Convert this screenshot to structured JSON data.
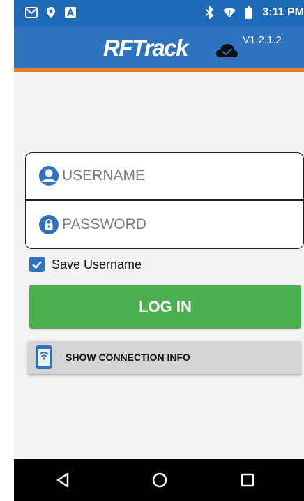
{
  "status_bar": {
    "time": "3:11 PM",
    "icons": [
      "gmail-icon",
      "location-pin-icon",
      "app-a-icon",
      "bluetooth-icon",
      "wifi-icon",
      "battery-icon"
    ]
  },
  "app_bar": {
    "brand": "RFTrack",
    "version": "V1.2.1.2",
    "icon": "cloud-check-icon",
    "accent_color": "#e67e22",
    "bar_color": "#2e72c0"
  },
  "login": {
    "username_placeholder": "USERNAME",
    "username_value": "",
    "password_placeholder": "PASSWORD",
    "password_value": "",
    "save_username_label": "Save Username",
    "save_username_checked": true,
    "login_label": "LOG IN",
    "login_color": "#4caf50",
    "connection_info_label": "SHOW CONNECTION INFO"
  },
  "nav_bar": {
    "icons": [
      "back-triangle-icon",
      "home-circle-icon",
      "recent-apps-square-icon"
    ]
  }
}
